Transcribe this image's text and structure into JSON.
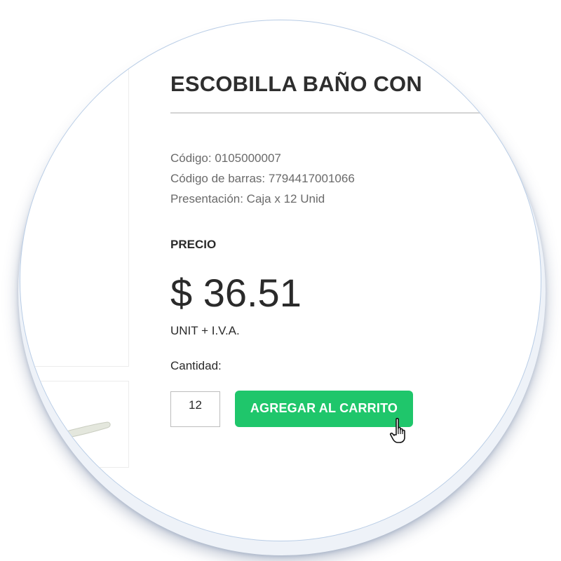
{
  "product": {
    "title": "ESCOBILLA BAÑO CON",
    "code": "Código: 0105000007",
    "barcode": "Código de barras: 7794417001066",
    "presentation": "Presentación: Caja x 12 Unid"
  },
  "pricing": {
    "label": "PRECIO",
    "price": "$ 36.51",
    "unit": "UNIT + I.V.A."
  },
  "purchase": {
    "quantity_label": "Cantidad:",
    "quantity_value": "12",
    "add_to_cart_label": "AGREGAR AL CARRITO"
  },
  "colors": {
    "accent": "#1fc66b",
    "lens_border": "#b9cde6"
  },
  "icons": {
    "pointer": "hand-pointer-cursor-icon"
  }
}
